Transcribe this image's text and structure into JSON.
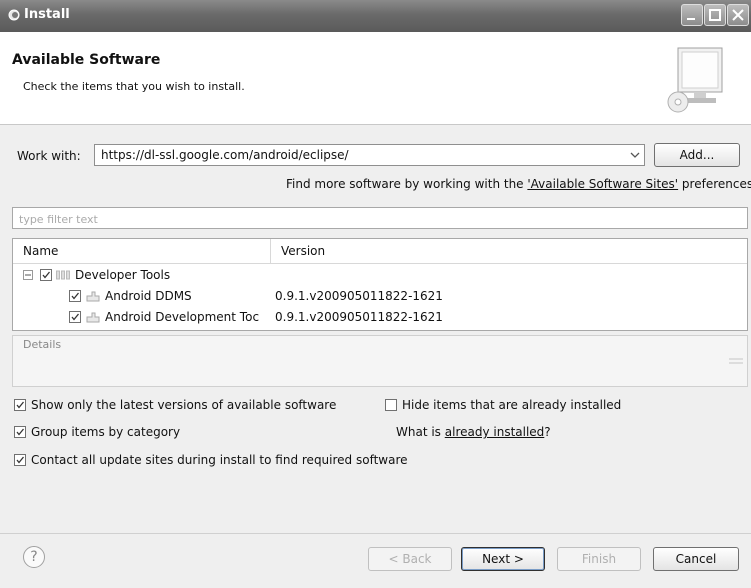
{
  "window": {
    "title": "Install",
    "icons": [
      "app-icon",
      "minimize-icon",
      "maximize-icon",
      "close-icon"
    ]
  },
  "header": {
    "title": "Available Software",
    "description": "Check the items that you wish to install.",
    "icon": "computer-monitor-icon"
  },
  "work_with": {
    "label": "Work with:",
    "value": "https://dl-ssl.google.com/android/eclipse/",
    "add_label": "Add...",
    "hint_prefix": "Find more software by working with the ",
    "hint_link": "'Available Software Sites'",
    "hint_suffix": " preferences."
  },
  "filter": {
    "placeholder": "type filter text"
  },
  "tree": {
    "columns": [
      "Name",
      "Version"
    ],
    "rows": [
      {
        "name": "Developer Tools",
        "version": "",
        "checked": true,
        "expanded": true,
        "level": 0
      },
      {
        "name": "Android DDMS",
        "version": "0.9.1.v200905011822-1621",
        "checked": true,
        "level": 1
      },
      {
        "name": "Android Development Toc",
        "version": "0.9.1.v200905011822-1621",
        "checked": true,
        "level": 1
      }
    ]
  },
  "details": {
    "label": "Details"
  },
  "options": {
    "show_latest": {
      "label": "Show only the latest versions of available software",
      "checked": true
    },
    "hide_installed": {
      "label": "Hide items that are already installed",
      "checked": false
    },
    "group_by_category": {
      "label": "Group items by category",
      "checked": true
    },
    "what_is_prefix": "What is ",
    "what_is_link": "already installed",
    "what_is_suffix": "?",
    "contact_all": {
      "label": "Contact all update sites during install to find required software",
      "checked": true
    }
  },
  "footer": {
    "help": "?",
    "back": "< Back",
    "next": "Next >",
    "finish": "Finish",
    "cancel": "Cancel"
  }
}
